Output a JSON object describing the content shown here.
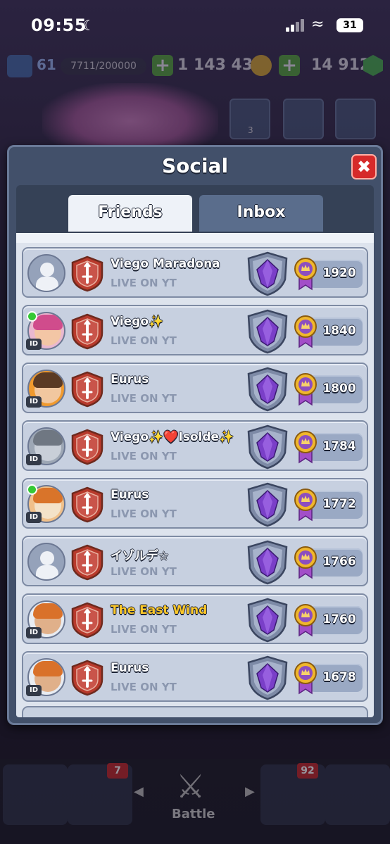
{
  "status_bar": {
    "time": "09:55",
    "battery": "31"
  },
  "hud": {
    "level": "61",
    "xp": "7711/200000",
    "gold": "1 143 438",
    "gems": "14 912"
  },
  "banner": {
    "friends_online": "3"
  },
  "bottom_nav": {
    "cards_count": "7",
    "events_count": "92",
    "battle_label": "Battle"
  },
  "panel": {
    "title": "Social",
    "tabs": [
      {
        "label": "Friends",
        "selected": true
      },
      {
        "label": "Inbox",
        "selected": false
      }
    ]
  },
  "friends": [
    {
      "name": "Viego Maradona",
      "status": "LIVE ON YT",
      "trophies": "1920",
      "online": false,
      "avatar": "default"
    },
    {
      "name": "Viego✨",
      "status": "LIVE ON YT",
      "trophies": "1840",
      "online": true,
      "avatar": "archer-queen"
    },
    {
      "name": "Eurus",
      "status": "LIVE ON YT",
      "trophies": "1800",
      "online": false,
      "avatar": "boy-orange"
    },
    {
      "name": "Viego✨❤️Isolde✨",
      "status": "LIVE ON YT",
      "trophies": "1784",
      "online": false,
      "avatar": "cat-grey"
    },
    {
      "name": "Eurus",
      "status": "LIVE ON YT",
      "trophies": "1772",
      "online": true,
      "avatar": "fox-orange"
    },
    {
      "name": "イゾルデ☆",
      "status": "LIVE ON YT",
      "trophies": "1766",
      "online": false,
      "avatar": "default"
    },
    {
      "name": "The East Wind",
      "status": "LIVE ON YT",
      "trophies": "1760",
      "online": false,
      "avatar": "builder-blue",
      "gold_name": true
    },
    {
      "name": "Eurus",
      "status": "LIVE ON YT",
      "trophies": "1678",
      "online": false,
      "avatar": "builder-blue"
    }
  ],
  "colors": {
    "panel_bg": "#42506a",
    "row_bg": "#c7d0e0",
    "close_red": "#d62a2a",
    "online_green": "#35c935",
    "arena_purple": "#7a3fc8",
    "clan_red": "#b83a2c"
  }
}
